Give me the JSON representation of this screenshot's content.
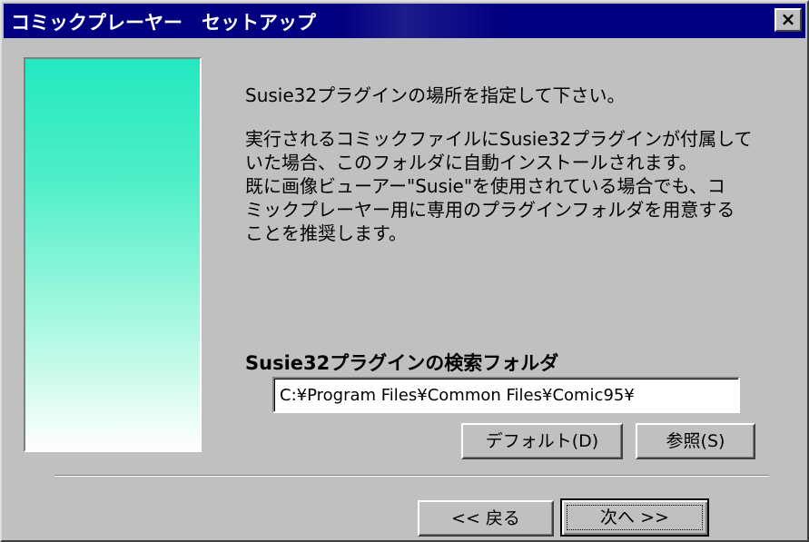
{
  "window": {
    "title": "コミックプレーヤー　セットアップ",
    "close_label": "×"
  },
  "message": {
    "line1": "Susie32プラグインの場所を指定して下さい。",
    "paragraph": [
      "実行されるコミックファイルにSusie32プラグインが付属して",
      "いた場合、このフォルダに自動インストールされます。",
      "既に画像ビューアー\"Susie\"を使用されている場合でも、コ",
      "ミックプレーヤー用に専用のプラグインフォルダを用意する",
      "ことを推奨します。"
    ]
  },
  "folder": {
    "label": "Susie32プラグインの検索フォルダ",
    "path": "C:¥Program Files¥Common Files¥Comic95¥"
  },
  "buttons": {
    "default": "デフォルト(D)",
    "browse": "参照(S)",
    "back": "<< 戻る",
    "next": "次へ >>"
  }
}
